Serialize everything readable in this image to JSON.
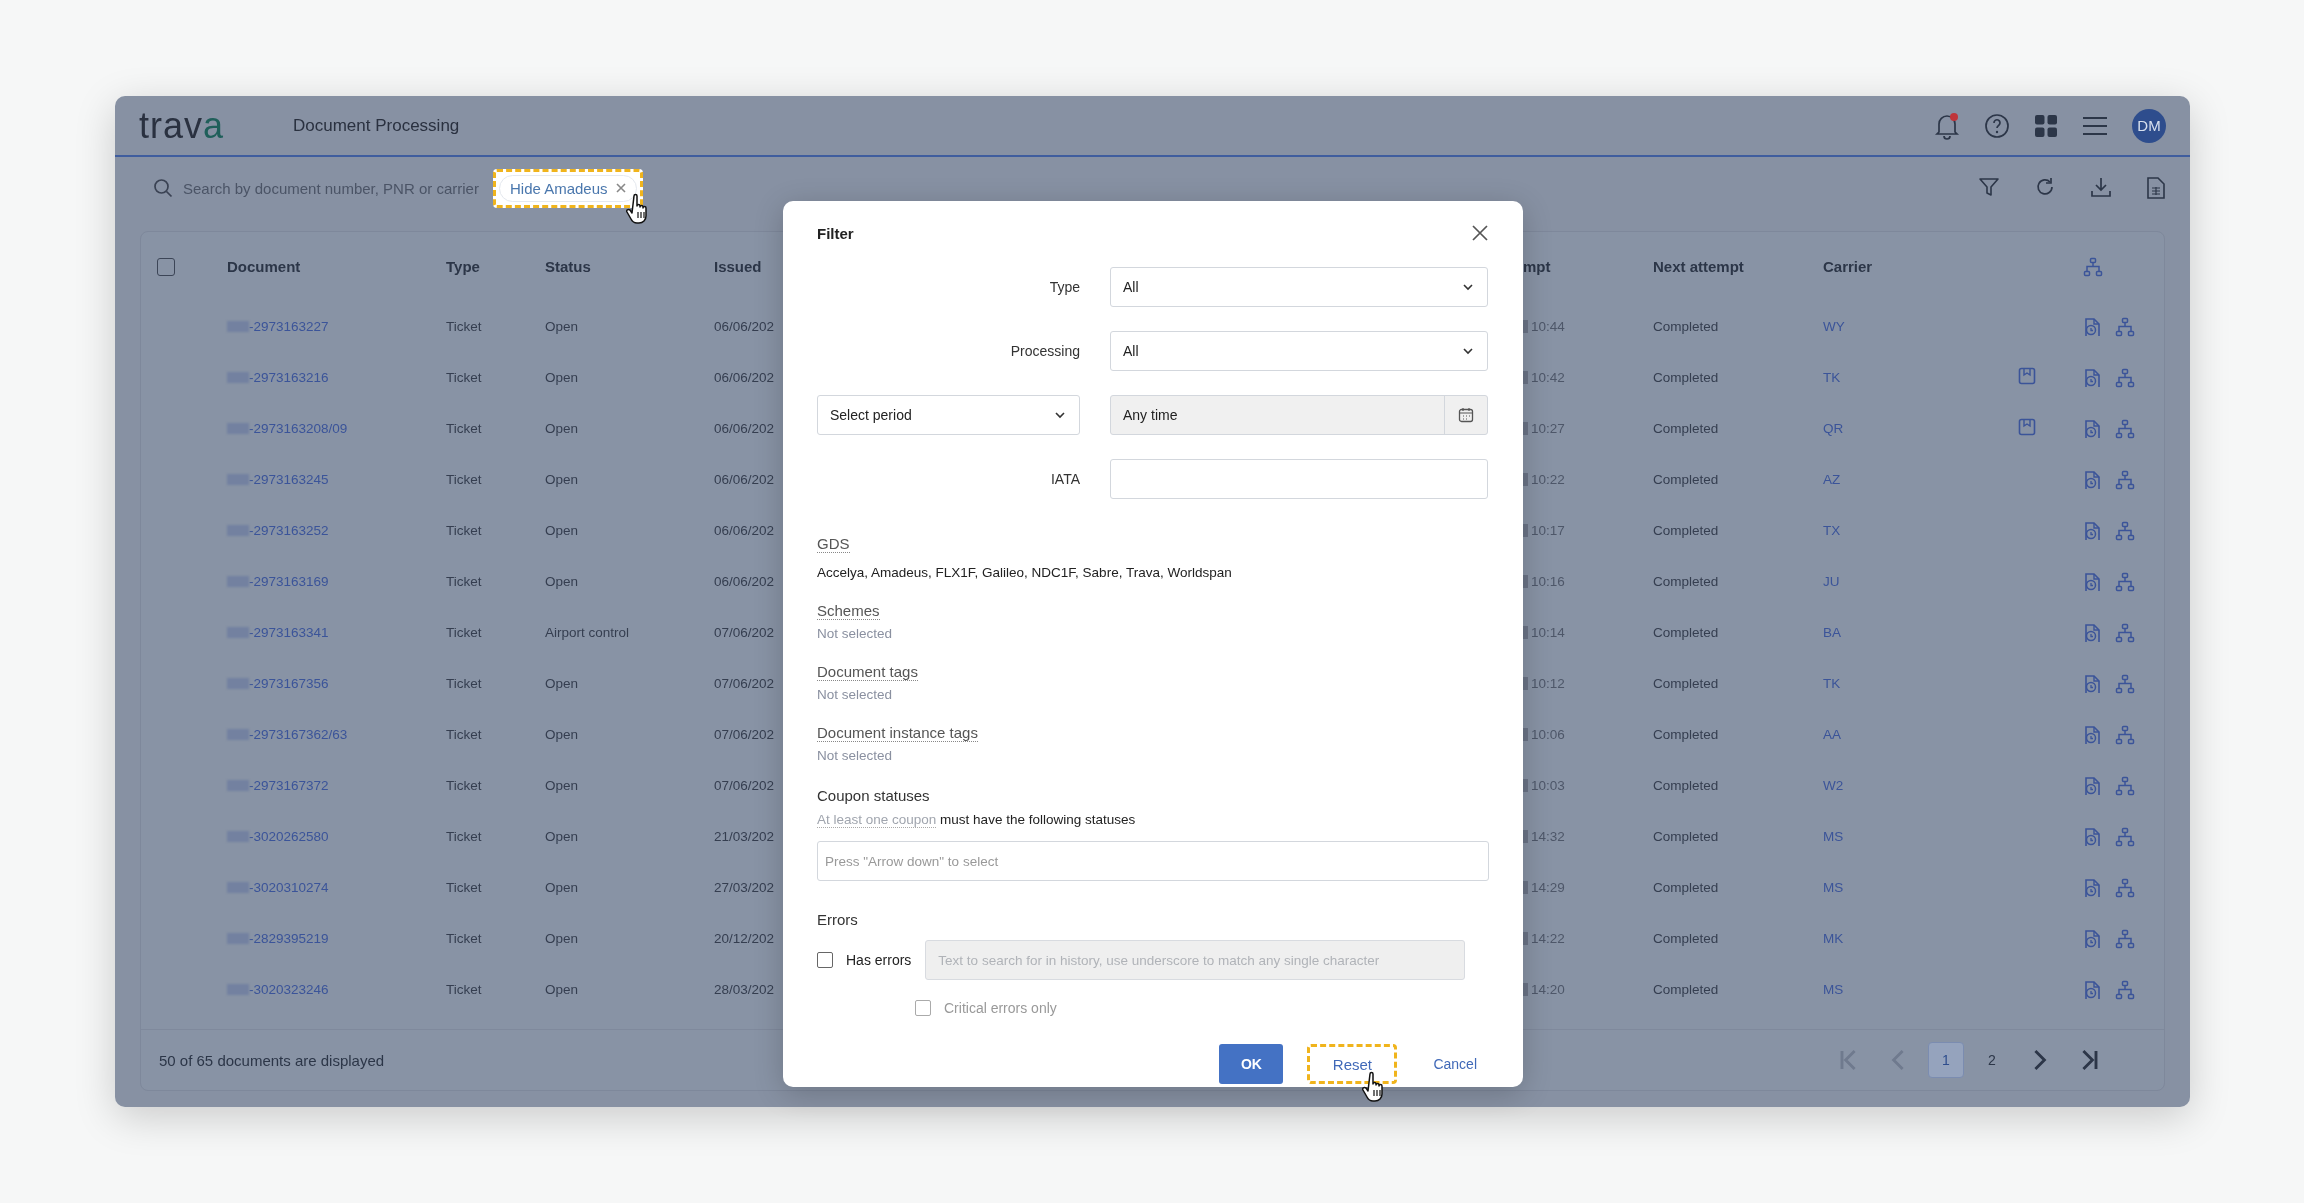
{
  "app": {
    "logo": "trava",
    "title": "Document Processing",
    "has_notifications": true,
    "avatar": "DM"
  },
  "toolbar": {
    "search_placeholder": "Search by document number, PNR or carrier",
    "chip": {
      "label": "Hide Amadeus",
      "highlighted": true,
      "pointer": true
    }
  },
  "table": {
    "select_all_checked": false,
    "columns": [
      {
        "label": "Document"
      },
      {
        "label": "Type"
      },
      {
        "label": "Status"
      },
      {
        "label": "Issued"
      },
      {
        "label": "mpt"
      },
      {
        "label": "Next attempt"
      },
      {
        "label": "Carrier"
      }
    ],
    "rows": [
      {
        "document": "-2973163227",
        "type": "Ticket",
        "status": "Open",
        "issued": "06/06/202",
        "attempt_time": "10:44",
        "next_attempt": "Completed",
        "carrier": "WY",
        "flagged": false
      },
      {
        "document": "-2973163216",
        "type": "Ticket",
        "status": "Open",
        "issued": "06/06/202",
        "attempt_time": "10:42",
        "next_attempt": "Completed",
        "carrier": "TK",
        "flagged": true
      },
      {
        "document": "-2973163208/09",
        "type": "Ticket",
        "status": "Open",
        "issued": "06/06/202",
        "attempt_time": "10:27",
        "next_attempt": "Completed",
        "carrier": "QR",
        "flagged": true
      },
      {
        "document": "-2973163245",
        "type": "Ticket",
        "status": "Open",
        "issued": "06/06/202",
        "attempt_time": "10:22",
        "next_attempt": "Completed",
        "carrier": "AZ",
        "flagged": false
      },
      {
        "document": "-2973163252",
        "type": "Ticket",
        "status": "Open",
        "issued": "06/06/202",
        "attempt_time": "10:17",
        "next_attempt": "Completed",
        "carrier": "TX",
        "flagged": false
      },
      {
        "document": "-2973163169",
        "type": "Ticket",
        "status": "Open",
        "issued": "06/06/202",
        "attempt_time": "10:16",
        "next_attempt": "Completed",
        "carrier": "JU",
        "flagged": false
      },
      {
        "document": "-2973163341",
        "type": "Ticket",
        "status": "Airport control",
        "issued": "07/06/202",
        "attempt_time": "10:14",
        "next_attempt": "Completed",
        "carrier": "BA",
        "flagged": false
      },
      {
        "document": "-2973167356",
        "type": "Ticket",
        "status": "Open",
        "issued": "07/06/202",
        "attempt_time": "10:12",
        "next_attempt": "Completed",
        "carrier": "TK",
        "flagged": false
      },
      {
        "document": "-2973167362/63",
        "type": "Ticket",
        "status": "Open",
        "issued": "07/06/202",
        "attempt_time": "10:06",
        "next_attempt": "Completed",
        "carrier": "AA",
        "flagged": false
      },
      {
        "document": "-2973167372",
        "type": "Ticket",
        "status": "Open",
        "issued": "07/06/202",
        "attempt_time": "10:03",
        "next_attempt": "Completed",
        "carrier": "W2",
        "flagged": false
      },
      {
        "document": "-3020262580",
        "type": "Ticket",
        "status": "Open",
        "issued": "21/03/202",
        "attempt_time": "14:32",
        "next_attempt": "Completed",
        "carrier": "MS",
        "flagged": false
      },
      {
        "document": "-3020310274",
        "type": "Ticket",
        "status": "Open",
        "issued": "27/03/202",
        "attempt_time": "14:29",
        "next_attempt": "Completed",
        "carrier": "MS",
        "flagged": false
      },
      {
        "document": "-2829395219",
        "type": "Ticket",
        "status": "Open",
        "issued": "20/12/202",
        "attempt_time": "14:22",
        "next_attempt": "Completed",
        "carrier": "MK",
        "flagged": false
      },
      {
        "document": "-3020323246",
        "type": "Ticket",
        "status": "Open",
        "issued": "28/03/202",
        "attempt_time": "14:20",
        "next_attempt": "Completed",
        "carrier": "MS",
        "flagged": false
      }
    ]
  },
  "footer": {
    "summary": "50 of 65 documents are displayed",
    "pagination": [
      {
        "kind": "first",
        "disabled": true
      },
      {
        "kind": "prev",
        "disabled": true
      },
      {
        "kind": "page",
        "label": "1",
        "selected": true
      },
      {
        "kind": "page",
        "label": "2",
        "selected": false
      },
      {
        "kind": "next",
        "disabled": false
      },
      {
        "kind": "last",
        "disabled": false
      }
    ]
  },
  "filter_dialog": {
    "title": "Filter",
    "type": {
      "label": "Type",
      "value": "All"
    },
    "processing": {
      "label": "Processing",
      "value": "All"
    },
    "period": {
      "value": "Select period"
    },
    "date": {
      "value": "Any time"
    },
    "iata": {
      "label": "IATA"
    },
    "sections": [
      {
        "heading": "GDS",
        "value": "Accelya, Amadeus, FLX1F, Galileo, NDC1F, Sabre, Trava, Worldspan",
        "kind": "value"
      },
      {
        "heading": "Schemes",
        "value": "Not selected",
        "kind": "empty"
      },
      {
        "heading": "Document tags",
        "value": "Not selected",
        "kind": "empty"
      },
      {
        "heading": "Document instance tags",
        "value": "Not selected",
        "kind": "empty"
      }
    ],
    "coupon_statuses": {
      "heading": "Coupon statuses",
      "hint_term": "At least one coupon",
      "hint_rest": "must have the following statuses",
      "placeholder": "Press \"Arrow down\" to select"
    },
    "errors": {
      "heading": "Errors",
      "has_errors": {
        "label": "Has errors",
        "checked": false
      },
      "search": {
        "placeholder": "Text to search for in history, use underscore to match any single character",
        "disabled": true
      },
      "critical_only": {
        "label": "Critical errors only",
        "checked": false,
        "disabled": true
      }
    },
    "buttons": [
      {
        "label": "OK",
        "kind": "primary",
        "highlighted": false,
        "pointer": false
      },
      {
        "label": "Reset",
        "kind": "link",
        "highlighted": true,
        "pointer": true
      },
      {
        "label": "Cancel",
        "kind": "link",
        "highlighted": false,
        "pointer": false
      }
    ]
  }
}
